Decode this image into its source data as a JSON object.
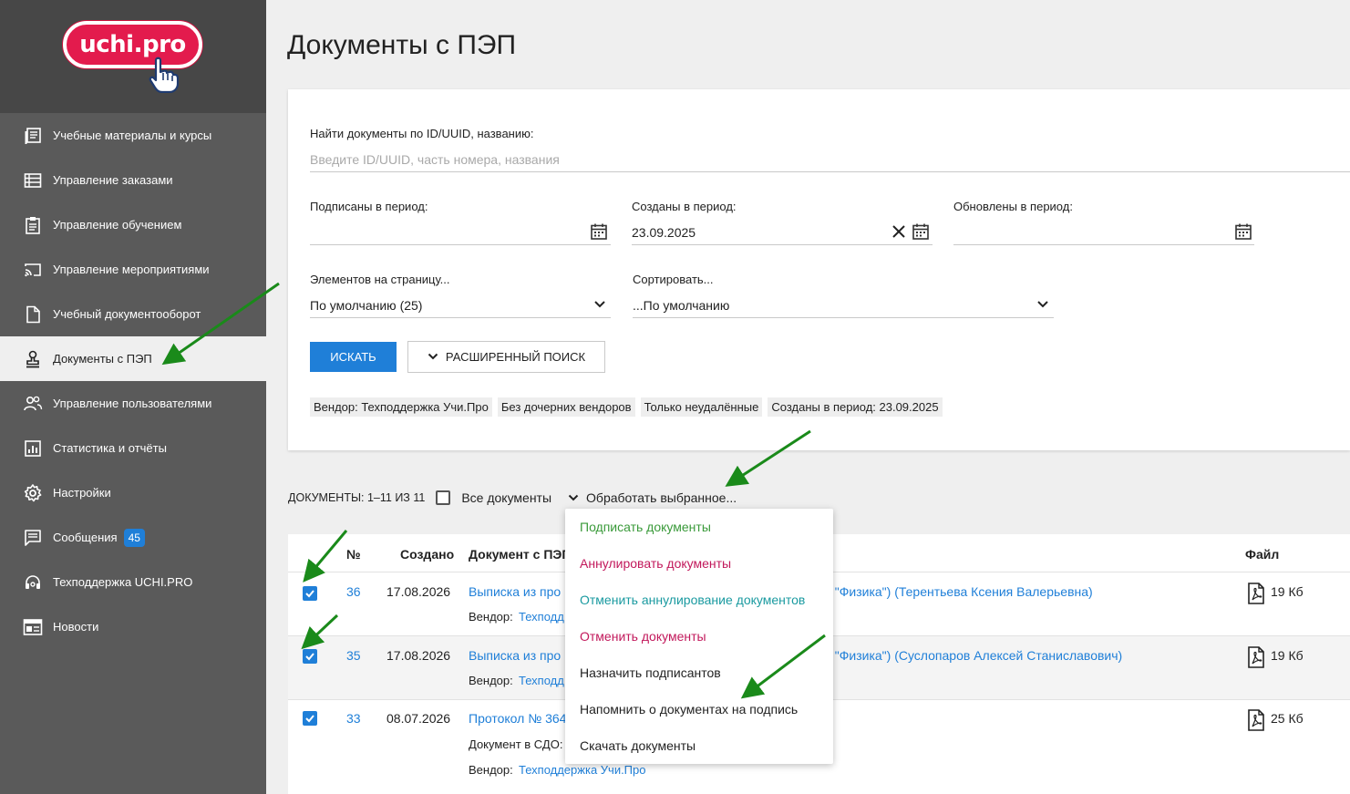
{
  "logo": {
    "text": "uchi.pro"
  },
  "sidebar": {
    "items": [
      {
        "label": "Учебные материалы и курсы",
        "icon": "book-icon"
      },
      {
        "label": "Управление заказами",
        "icon": "list-icon"
      },
      {
        "label": "Управление обучением",
        "icon": "clipboard-icon"
      },
      {
        "label": "Управление мероприятиями",
        "icon": "cast-icon"
      },
      {
        "label": "Учебный документооборот",
        "icon": "document-icon"
      },
      {
        "label": "Документы с ПЭП",
        "icon": "stamp-icon",
        "active": true
      },
      {
        "label": "Управление пользователями",
        "icon": "users-icon"
      },
      {
        "label": "Статистика и отчёты",
        "icon": "chart-icon"
      },
      {
        "label": "Настройки",
        "icon": "gear-icon"
      },
      {
        "label": "Сообщения",
        "icon": "message-icon",
        "badge": "45"
      },
      {
        "label": "Техподдержка UCHI.PRO",
        "icon": "headset-icon"
      },
      {
        "label": "Новости",
        "icon": "news-icon"
      }
    ]
  },
  "page": {
    "title": "Документы с ПЭП"
  },
  "filters": {
    "search_label": "Найти документы по ID/UUID, названию:",
    "search_placeholder": "Введите ID/UUID, часть номера, названия",
    "signed_label": "Подписаны в период:",
    "signed_value": "",
    "created_label": "Созданы в период:",
    "created_value": "23.09.2025",
    "updated_label": "Обновлены в период:",
    "updated_value": "",
    "per_page_label": "Элементов на страницу...",
    "per_page_value": "По умолчанию (25)",
    "sort_label": "Сортировать...",
    "sort_value": "...По умолчанию",
    "search_button": "ИСКАТЬ",
    "advanced_button": "РАСШИРЕННЫЙ ПОИСК",
    "chips": [
      "Вендор: Техподдержка Учи.Про",
      "Без дочерних вендоров",
      "Только неудалённые",
      "Созданы в период: 23.09.2025"
    ]
  },
  "toolbar": {
    "count": "ДОКУМЕНТЫ: 1–11 ИЗ 11",
    "all_docs": "Все документы",
    "process": "Обработать выбранное..."
  },
  "table": {
    "headers": {
      "num": "№",
      "created": "Создано",
      "doc": "Документ с ПЭП",
      "file": "Файл"
    },
    "rows": [
      {
        "num": "36",
        "date": "17.08.2026",
        "doc_start": "Выписка из про",
        "doc_end": "О \"Физика\") (Терентьева Ксения Валерьевна)",
        "vendor_label": "Вендор:",
        "vendor": "Техподд",
        "file": "19 Кб",
        "checked": true
      },
      {
        "num": "35",
        "date": "17.08.2026",
        "doc_start": "Выписка из про",
        "doc_end": "О \"Физика\") (Суслопаров Алексей Станиславович)",
        "vendor_label": "Вендор:",
        "vendor": "Техподд",
        "file": "19 Кб",
        "checked": true
      },
      {
        "num": "33",
        "date": "08.07.2026",
        "doc_start": "Протокол № 364",
        "sdo_label": "Документ в СДО:",
        "vendor_label": "Вендор:",
        "vendor": "Техподдержка Учи.Про",
        "file": "25 Кб",
        "checked": true
      }
    ]
  },
  "menu": {
    "items": [
      {
        "label": "Подписать документы",
        "color": "#3a9a3a"
      },
      {
        "label": "Аннулировать документы",
        "color": "#c2185b"
      },
      {
        "label": "Отменить аннулирование документов",
        "color": "#1a9aa0"
      },
      {
        "label": "Отменить документы",
        "color": "#c2185b"
      },
      {
        "label": "Назначить подписантов",
        "color": "#222222"
      },
      {
        "label": "Напомнить о документах на подпись",
        "color": "#222222"
      },
      {
        "label": "Скачать документы",
        "color": "#222222"
      }
    ]
  },
  "colors": {
    "accent": "#1f7fd8",
    "sidebar": "#5a5a5a",
    "brand": "#e31b4d",
    "annotation_arrow": "#1a8a1a"
  }
}
